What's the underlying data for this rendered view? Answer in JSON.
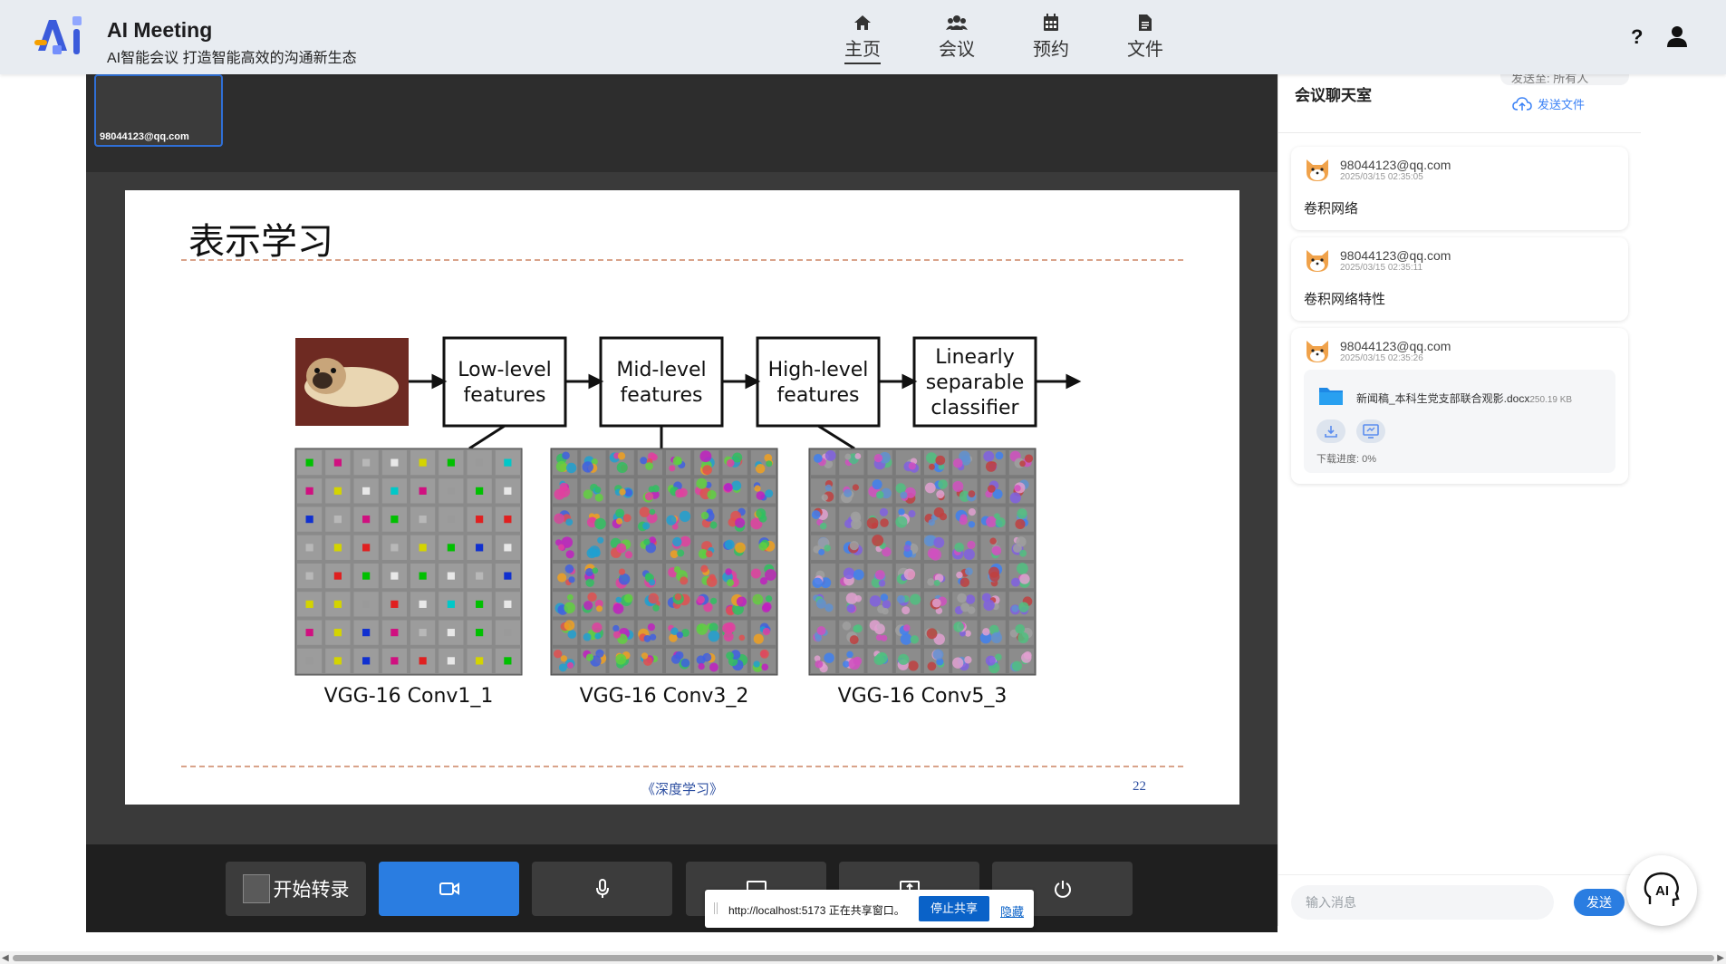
{
  "header": {
    "title": "AI Meeting",
    "subtitle": "AI智能会议 打造智能高效的沟通新生态",
    "nav": [
      {
        "label": "主页",
        "icon": "home-icon",
        "active": true
      },
      {
        "label": "会议",
        "icon": "users-icon",
        "active": false
      },
      {
        "label": "预约",
        "icon": "calendar-icon",
        "active": false
      },
      {
        "label": "文件",
        "icon": "file-icon",
        "active": false
      }
    ],
    "help_label": "?"
  },
  "video": {
    "participant_label": "98044123@qq.com"
  },
  "slide": {
    "title": "表示学习",
    "footer": "《深度学习》",
    "page": "22",
    "boxes": [
      "Low-level features",
      "Mid-level features",
      "High-level features",
      "Linearly separable classifier"
    ],
    "captions": [
      "VGG-16 Conv1_1",
      "VGG-16 Conv3_2",
      "VGG-16 Conv5_3"
    ]
  },
  "controls": {
    "record_label": "开始转录"
  },
  "share_bar": {
    "text": "http://localhost:5173 正在共享窗口。",
    "stop_label": "停止共享",
    "hide_label": "隐藏"
  },
  "chat": {
    "title": "会议聊天室",
    "send_to": "发送至: 所有人",
    "send_file_label": "发送文件",
    "messages": [
      {
        "user": "98044123@qq.com",
        "time": "2025/03/15 02:35:05",
        "text": "卷积网络"
      },
      {
        "user": "98044123@qq.com",
        "time": "2025/03/15 02:35:11",
        "text": "卷积网络特性"
      },
      {
        "user": "98044123@qq.com",
        "time": "2025/03/15 02:35:26",
        "file": {
          "name": "新闻稿_本科生党支部联合观影.docx",
          "size": "250.19 KB",
          "progress": "下载进度: 0%"
        }
      }
    ],
    "input_placeholder": "输入消息",
    "send_label": "发送"
  },
  "colors": {
    "accent": "#2a7de1",
    "header_bg": "#e8ecf1",
    "video_bg": "#3a3a3a"
  }
}
